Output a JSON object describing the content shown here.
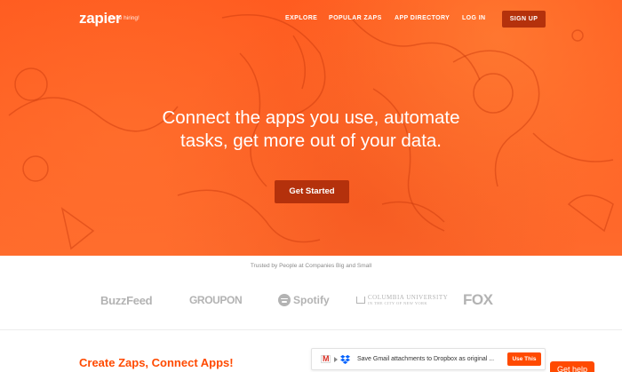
{
  "nav": {
    "logo": "zapier",
    "hiring": "we're hiring!",
    "links": [
      "EXPLORE",
      "POPULAR ZAPS",
      "APP DIRECTORY",
      "LOG IN"
    ],
    "signup": "SIGN UP"
  },
  "hero": {
    "headline_line1": "Connect the apps you use, automate",
    "headline_line2": "tasks, get more out of your data.",
    "cta": "Get Started",
    "background_color": "#ff5a1f",
    "button_color": "#b4310c"
  },
  "trusted": {
    "text": "Trusted by People at Companies Big and Small",
    "brands": {
      "buzzfeed": "BuzzFeed",
      "groupon": "GROUPON",
      "spotify": "Spotify",
      "columbia_main": "COLUMBIA UNIVERSITY",
      "columbia_sub": "IN THE CITY OF NEW YORK",
      "fox": "FOX"
    }
  },
  "bottom": {
    "title": "Create Zaps, Connect Apps!",
    "zap_card": {
      "text": "Save Gmail attachments to Dropbox as original ...",
      "button": "Use This",
      "icons": [
        "gmail-icon",
        "arrow-right-icon",
        "dropbox-icon"
      ]
    },
    "help": "Get help",
    "accent_color": "#ff4a00"
  }
}
